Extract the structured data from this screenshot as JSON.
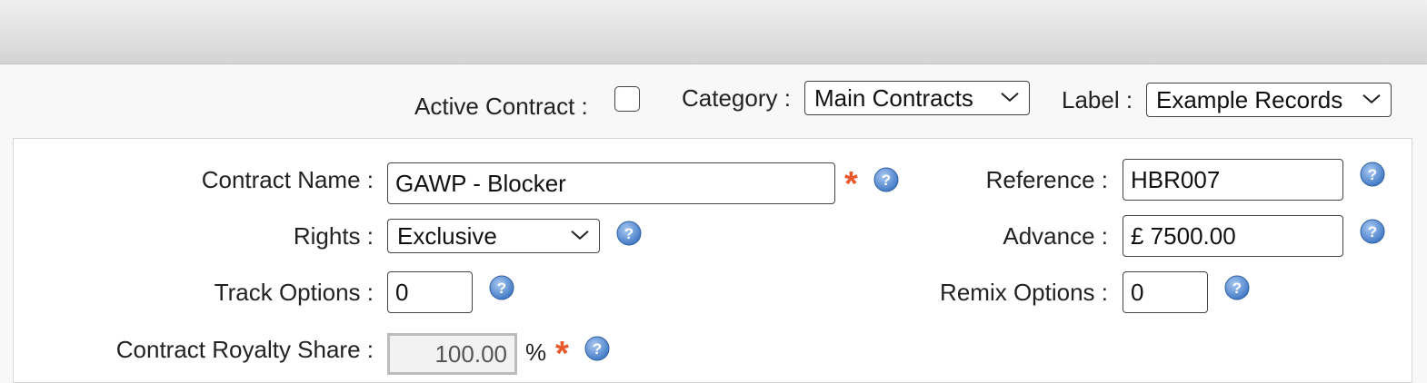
{
  "header": {
    "active_contract_label": "Active Contract :",
    "active_contract_checked": false,
    "category_label": "Category :",
    "category_value": "Main Contracts",
    "label_label": "Label :",
    "label_value": "Example Records"
  },
  "form": {
    "contract_name": {
      "label": "Contract Name :",
      "value": "GAWP - Blocker",
      "required_mark": "*"
    },
    "reference": {
      "label": "Reference :",
      "value": "HBR007"
    },
    "rights": {
      "label": "Rights :",
      "value": "Exclusive"
    },
    "advance": {
      "label": "Advance :",
      "value": "£ 7500.00"
    },
    "track_options": {
      "label": "Track Options :",
      "value": "0"
    },
    "remix_options": {
      "label": "Remix Options :",
      "value": "0"
    },
    "royalty_share": {
      "label": "Contract Royalty Share :",
      "value": "100.00",
      "unit": "%",
      "required_mark": "*"
    }
  },
  "icons": {
    "help": "help-icon",
    "dropdown": "chevron-down-icon",
    "required": "required-asterisk"
  },
  "colors": {
    "required": "#e8582c",
    "help_icon": "#3f7fd0"
  }
}
